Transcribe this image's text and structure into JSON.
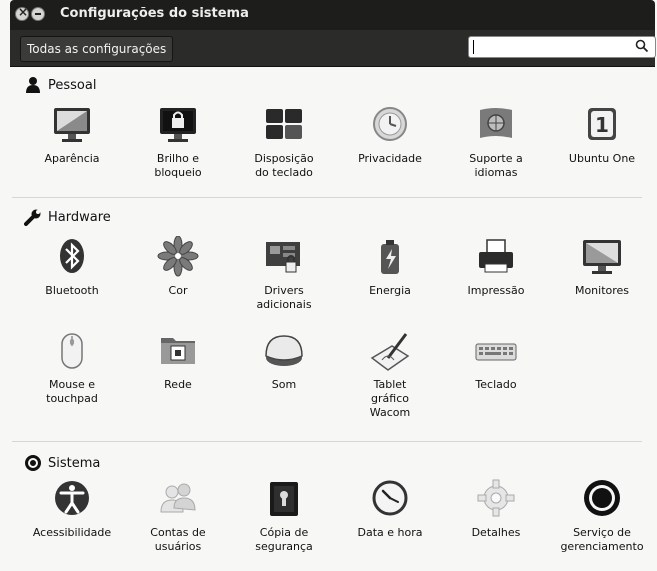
{
  "window": {
    "title": "Configurações do sistema"
  },
  "toolbar": {
    "all_settings_label": "Todas as configurações",
    "search": {
      "value": "",
      "placeholder": ""
    }
  },
  "sections": {
    "personal": {
      "title": "Pessoal",
      "icon": "person-icon",
      "items": [
        {
          "label": "Aparência",
          "icon": "appearance-icon"
        },
        {
          "label": "Brilho e\nbloqueio",
          "icon": "brightness-lock-icon"
        },
        {
          "label": "Disposição\ndo teclado",
          "icon": "keyboard-layout-icon"
        },
        {
          "label": "Privacidade",
          "icon": "privacy-icon"
        },
        {
          "label": "Suporte a\nidiomas",
          "icon": "language-support-icon"
        },
        {
          "label": "Ubuntu One",
          "icon": "ubuntu-one-icon"
        }
      ]
    },
    "hardware": {
      "title": "Hardware",
      "icon": "wrench-icon",
      "items": [
        {
          "label": "Bluetooth",
          "icon": "bluetooth-icon"
        },
        {
          "label": "Cor",
          "icon": "color-icon"
        },
        {
          "label": "Drivers\nadicionais",
          "icon": "drivers-icon"
        },
        {
          "label": "Energia",
          "icon": "power-icon"
        },
        {
          "label": "Impressão",
          "icon": "printer-icon"
        },
        {
          "label": "Monitores",
          "icon": "monitor-icon"
        },
        {
          "label": "Mouse e\ntouchpad",
          "icon": "mouse-icon"
        },
        {
          "label": "Rede",
          "icon": "network-icon"
        },
        {
          "label": "Som",
          "icon": "sound-icon"
        },
        {
          "label": "Tablet\ngráfico\nWacom",
          "icon": "wacom-tablet-icon"
        },
        {
          "label": "Teclado",
          "icon": "keyboard-icon"
        }
      ]
    },
    "system": {
      "title": "Sistema",
      "icon": "system-icon",
      "items": [
        {
          "label": "Acessibilidade",
          "icon": "accessibility-icon"
        },
        {
          "label": "Contas de\nusuários",
          "icon": "user-accounts-icon"
        },
        {
          "label": "Cópia de\nsegurança",
          "icon": "backup-icon"
        },
        {
          "label": "Data e hora",
          "icon": "clock-icon"
        },
        {
          "label": "Detalhes",
          "icon": "details-gear-icon"
        },
        {
          "label": "Serviço de\ngerenciamento",
          "icon": "management-service-icon"
        }
      ]
    }
  }
}
